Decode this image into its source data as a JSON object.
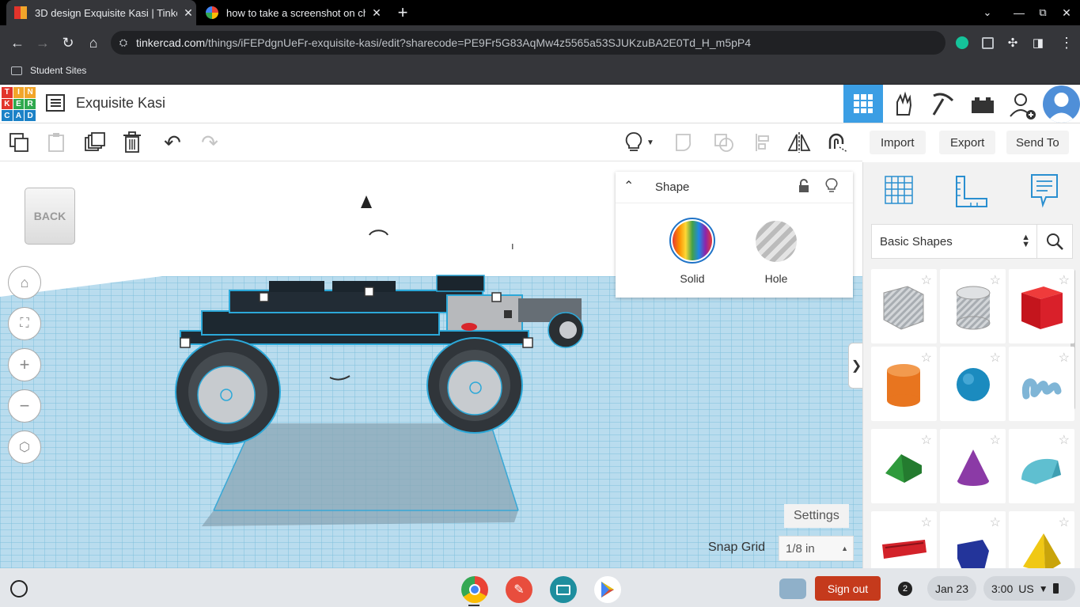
{
  "browser": {
    "tabs": [
      {
        "title": "3D design Exquisite Kasi | Tinke",
        "active": true
      },
      {
        "title": "how to take a screenshot on chr",
        "active": false
      }
    ],
    "new_tab": "+",
    "url_host": "tinkercad.com",
    "url_path": "/things/iFEPdgnUeFr-exquisite-kasi/edit?sharecode=PE9Fr5G83AqMw4z5565a53SJUKzuBA2E0Td_H_m5pP4",
    "bookmark": "Student Sites"
  },
  "tinkercad": {
    "logo_letters": [
      "T",
      "I",
      "N",
      "K",
      "E",
      "R",
      "C",
      "A",
      "D"
    ],
    "design_title": "Exquisite Kasi",
    "actions": {
      "import": "Import",
      "export": "Export",
      "send_to": "Send To"
    },
    "viewcube": "BACK",
    "shape_panel": {
      "title": "Shape",
      "solid": "Solid",
      "hole": "Hole"
    },
    "library": {
      "category": "Basic Shapes"
    },
    "settings": "Settings",
    "snap_grid_label": "Snap Grid",
    "snap_grid_value": "1/8 in",
    "collapse_arrow": "❯"
  },
  "shapes": [
    {
      "name": "box-hole",
      "color": "#b7bcc2"
    },
    {
      "name": "cylinder-hole",
      "color": "#c3c6ca"
    },
    {
      "name": "box",
      "color": "#d9202a"
    },
    {
      "name": "cylinder",
      "color": "#e8751f"
    },
    {
      "name": "sphere",
      "color": "#1b8bbf"
    },
    {
      "name": "scribble",
      "color": "#7fb5d6"
    },
    {
      "name": "roof",
      "color": "#2f9a3c"
    },
    {
      "name": "cone",
      "color": "#8b3aa6"
    },
    {
      "name": "round-roof",
      "color": "#5fbfd0"
    },
    {
      "name": "text",
      "color": "#d3222a"
    },
    {
      "name": "polygon",
      "color": "#23349a"
    },
    {
      "name": "pyramid",
      "color": "#f0c814"
    }
  ],
  "taskbar": {
    "sign_out": "Sign out",
    "notifications": "2",
    "date": "Jan 23",
    "time": "3:00",
    "locale": "US"
  }
}
